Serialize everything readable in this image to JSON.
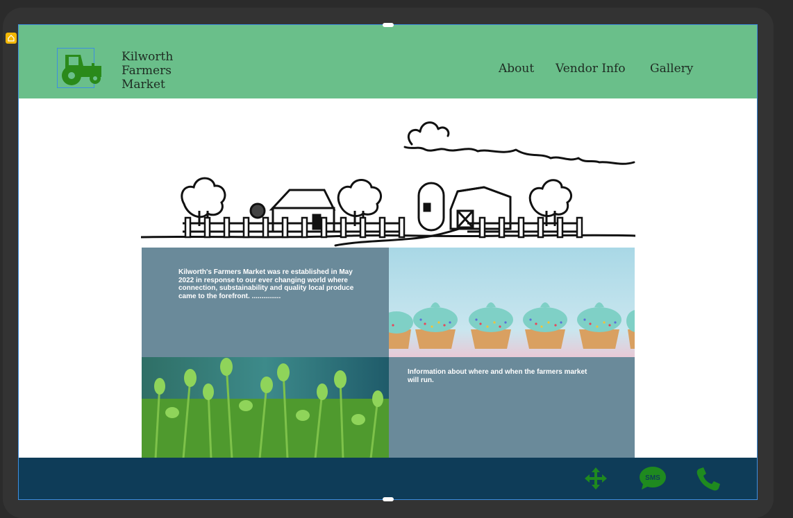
{
  "site": {
    "brand_lines": [
      "Kilworth",
      "Farmers",
      "Market"
    ],
    "nav": [
      {
        "label": "About"
      },
      {
        "label": "Vendor Info"
      },
      {
        "label": "Gallery"
      }
    ]
  },
  "content": {
    "intro_text": "Kilworth's Farmers Market was re established in May 2022 in response to our ever changing world where connection, substainability and quality local produce came to the forefront. ...............",
    "info_text": "Information about where and when the farmers market will run."
  },
  "footer": {
    "icons": [
      "move-icon",
      "sms-icon",
      "phone-icon"
    ],
    "sms_label": "SMS"
  },
  "colors": {
    "header_bg": "#6abf8a",
    "footer_bg": "#0e3c58",
    "text_panel_bg": "#6a8a9a",
    "icon_green": "#1f8a1f"
  }
}
